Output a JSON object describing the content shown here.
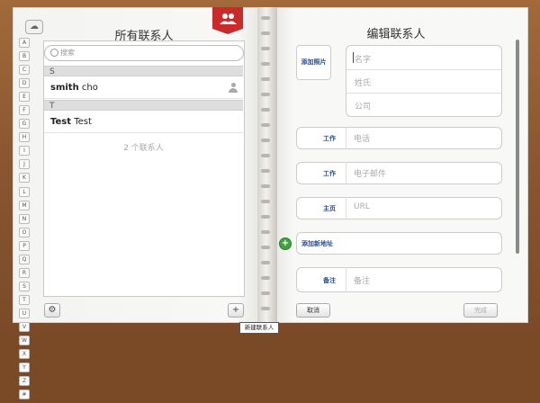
{
  "left": {
    "title": "所有联系人",
    "search_placeholder": "搜索",
    "index_letters": [
      "A",
      "B",
      "C",
      "D",
      "E",
      "F",
      "G",
      "H",
      "I",
      "J",
      "K",
      "L",
      "M",
      "N",
      "O",
      "P",
      "Q",
      "R",
      "S",
      "T",
      "U",
      "V",
      "W",
      "X",
      "Y",
      "Z",
      "#"
    ],
    "sections": [
      {
        "letter": "S",
        "contacts": [
          {
            "first": "smith",
            "last": "cho"
          }
        ]
      },
      {
        "letter": "T",
        "contacts": [
          {
            "first": "Test",
            "last": "Test"
          }
        ]
      }
    ],
    "count": "2 个联系人",
    "tooltip": "新建联系人"
  },
  "right": {
    "title": "编辑联系人",
    "add_photo": "添加照片",
    "first_name_placeholder": "名字",
    "last_name_placeholder": "姓氏",
    "company_placeholder": "公司",
    "phone": {
      "label": "工作",
      "placeholder": "电话"
    },
    "email": {
      "label": "工作",
      "placeholder": "电子邮件"
    },
    "url": {
      "label": "主页",
      "placeholder": "URL"
    },
    "add_address": "添加新地址",
    "notes": {
      "label": "备注",
      "placeholder": "备注"
    },
    "cancel": "取消",
    "done": "完成"
  }
}
